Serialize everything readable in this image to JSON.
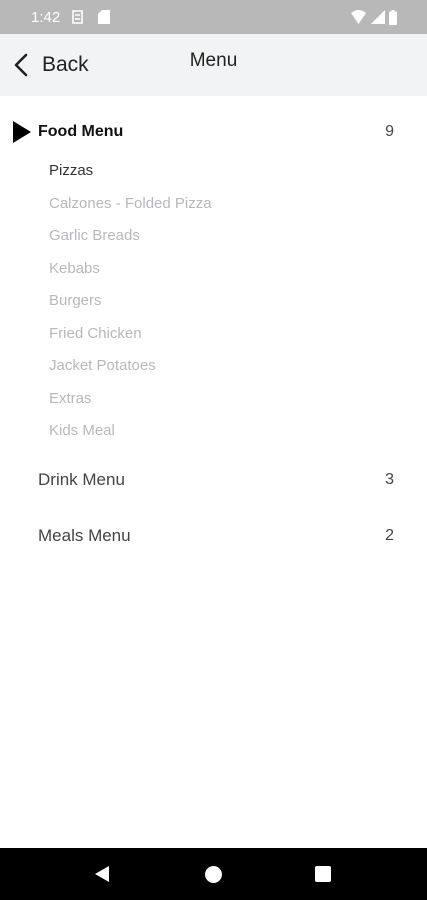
{
  "status_bar": {
    "time": "1:42",
    "icons": [
      "sim-icon",
      "sd-card-icon",
      "wifi-icon",
      "signal-icon",
      "battery-icon"
    ]
  },
  "header": {
    "back_label": "Back",
    "title": "Menu"
  },
  "categories": [
    {
      "label": "Food Menu",
      "count": "9",
      "expanded": true,
      "items": [
        {
          "label": "Pizzas",
          "selected": true
        },
        {
          "label": "Calzones - Folded Pizza",
          "selected": false
        },
        {
          "label": "Garlic Breads",
          "selected": false
        },
        {
          "label": "Kebabs",
          "selected": false
        },
        {
          "label": "Burgers",
          "selected": false
        },
        {
          "label": "Fried Chicken",
          "selected": false
        },
        {
          "label": "Jacket Potatoes",
          "selected": false
        },
        {
          "label": "Extras",
          "selected": false
        },
        {
          "label": "Kids Meal",
          "selected": false
        }
      ]
    },
    {
      "label": "Drink Menu",
      "count": "3",
      "expanded": false
    },
    {
      "label": "Meals Menu",
      "count": "2",
      "expanded": false
    }
  ],
  "nav_bar": {
    "icons": [
      "nav-back-icon",
      "nav-home-icon",
      "nav-recents-icon"
    ]
  },
  "colors": {
    "status_bar": "#b8b8b8",
    "header_bg": "#f2f3f4",
    "sub_item_muted": "#b5b9be",
    "sub_item_selected": "#333333",
    "nav_bar": "#000000"
  }
}
